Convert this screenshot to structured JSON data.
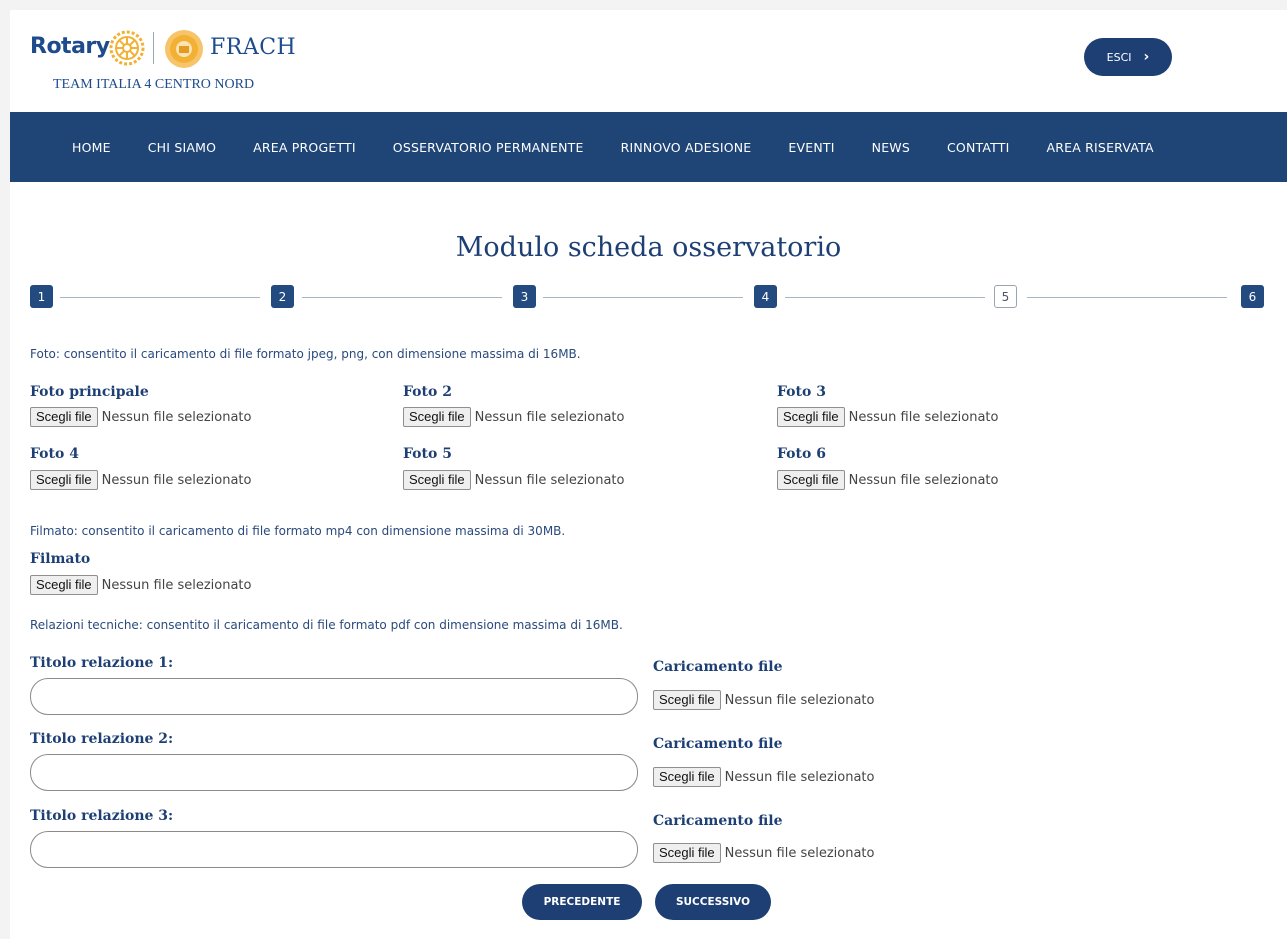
{
  "header": {
    "brand_rotary": "Rotary",
    "brand_frach": "FRACH",
    "team_line": "TEAM ITALIA 4 CENTRO NORD",
    "exit_label": "ESCI",
    "brand_colors": {
      "blue": "#1d4b8c",
      "gold": "#f2b134"
    }
  },
  "nav": {
    "items": [
      "HOME",
      "CHI SIAMO",
      "AREA PROGETTI",
      "OSSERVATORIO PERMANENTE",
      "RINNOVO ADESIONE",
      "EVENTI",
      "NEWS",
      "CONTATTI",
      "AREA RISERVATA"
    ]
  },
  "form": {
    "title": "Modulo scheda osservatorio",
    "steps": [
      "1",
      "2",
      "3",
      "4",
      "5",
      "6"
    ],
    "current_step": "5",
    "photo_note": "Foto: consentito il caricamento di file formato jpeg, png, con dimensione massima di 16MB.",
    "photos": [
      {
        "label": "Foto principale",
        "button": "Scegli file",
        "status": "Nessun file selezionato"
      },
      {
        "label": "Foto 2",
        "button": "Scegli file",
        "status": "Nessun file selezionato"
      },
      {
        "label": "Foto 3",
        "button": "Scegli file",
        "status": "Nessun file selezionato"
      },
      {
        "label": "Foto 4",
        "button": "Scegli file",
        "status": "Nessun file selezionato"
      },
      {
        "label": "Foto 5",
        "button": "Scegli file",
        "status": "Nessun file selezionato"
      },
      {
        "label": "Foto 6",
        "button": "Scegli file",
        "status": "Nessun file selezionato"
      }
    ],
    "video_note": "Filmato: consentito il caricamento di file formato mp4 con dimensione massima di 30MB.",
    "video": {
      "label": "Filmato",
      "button": "Scegli file",
      "status": "Nessun file selezionato"
    },
    "reports_note": "Relazioni tecniche: consentito il caricamento di file formato pdf con dimensione massima di 16MB.",
    "reports": [
      {
        "title_label": "Titolo relazione 1:",
        "title_value": "",
        "upload_label": "Caricamento file",
        "button": "Scegli file",
        "status": "Nessun file selezionato"
      },
      {
        "title_label": "Titolo relazione 2:",
        "title_value": "",
        "upload_label": "Caricamento file",
        "button": "Scegli file",
        "status": "Nessun file selezionato"
      },
      {
        "title_label": "Titolo relazione 3:",
        "title_value": "",
        "upload_label": "Caricamento file",
        "button": "Scegli file",
        "status": "Nessun file selezionato"
      }
    ],
    "prev_label": "PRECEDENTE",
    "next_label": "SUCCESSIVO"
  }
}
